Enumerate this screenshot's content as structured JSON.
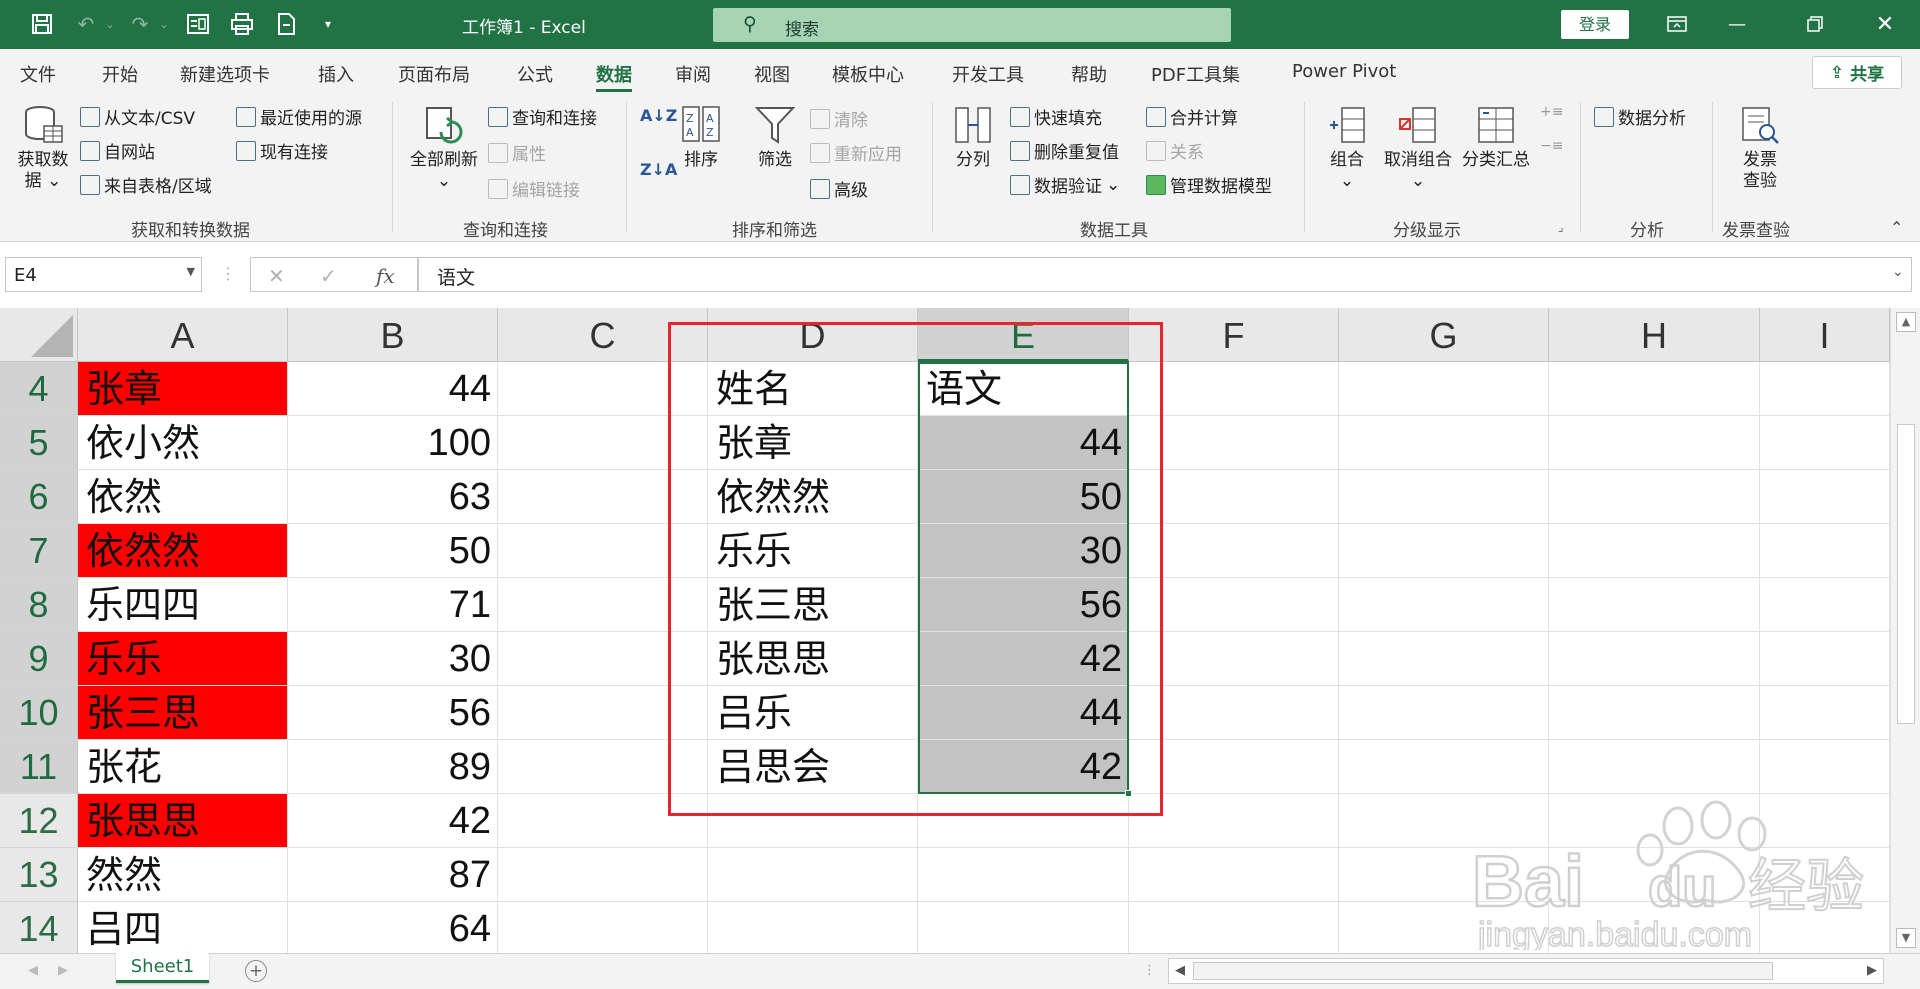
{
  "titlebar": {
    "doc_title": "工作簿1  -  Excel",
    "search_placeholder": "搜索",
    "login_label": "登录"
  },
  "ribbon_tabs": [
    "文件",
    "开始",
    "新建选项卡",
    "插入",
    "页面布局",
    "公式",
    "数据",
    "审阅",
    "视图",
    "模板中心",
    "开发工具",
    "帮助",
    "PDF工具集",
    "Power Pivot"
  ],
  "active_tab": "数据",
  "share_label": "共享",
  "ribbon": {
    "get_data": {
      "label1": "获取数",
      "label2": "据 ⌄"
    },
    "from_text": "从文本/CSV",
    "from_web": "自网站",
    "from_table": "来自表格/区域",
    "recent_sources": "最近使用的源",
    "existing_conn": "现有连接",
    "group_get": "获取和转换数据",
    "refresh_all": "全部刷新",
    "queries_conn": "查询和连接",
    "properties": "属性",
    "edit_links": "编辑链接",
    "group_query": "查询和连接",
    "sort": "排序",
    "filter": "筛选",
    "clear": "清除",
    "reapply": "重新应用",
    "advanced": "高级",
    "group_sort": "排序和筛选",
    "text_to_columns": "分列",
    "flash_fill": "快速填充",
    "remove_dup": "删除重复值",
    "data_validation": "数据验证",
    "consolidate": "合并计算",
    "relationships": "关系",
    "data_model": "管理数据模型",
    "group_tools": "数据工具",
    "group_btn": "组合",
    "ungroup_btn": "取消组合",
    "subtotal": "分类汇总",
    "group_outline": "分级显示",
    "data_analysis": "数据分析",
    "group_analysis": "分析",
    "invoice_check1": "发票",
    "invoice_check2": "查验",
    "group_invoice": "发票查验"
  },
  "formula_bar": {
    "name_box": "E4",
    "formula": "语文"
  },
  "columns": [
    "A",
    "B",
    "C",
    "D",
    "E",
    "F",
    "G",
    "H",
    "I"
  ],
  "rows": [
    {
      "num": "4",
      "A": "张章",
      "B": "44",
      "D": "姓名",
      "E": "语文",
      "redA": true
    },
    {
      "num": "5",
      "A": "依小然",
      "B": "100",
      "D": "张章",
      "E": "44",
      "redA": false
    },
    {
      "num": "6",
      "A": "依然",
      "B": "63",
      "D": "依然然",
      "E": "50",
      "redA": false
    },
    {
      "num": "7",
      "A": "依然然",
      "B": "50",
      "D": "乐乐",
      "E": "30",
      "redA": true
    },
    {
      "num": "8",
      "A": "乐四四",
      "B": "71",
      "D": "张三思",
      "E": "56",
      "redA": false
    },
    {
      "num": "9",
      "A": "乐乐",
      "B": "30",
      "D": "张思思",
      "E": "42",
      "redA": true
    },
    {
      "num": "10",
      "A": "张三思",
      "B": "56",
      "D": "吕乐",
      "E": "44",
      "redA": true
    },
    {
      "num": "11",
      "A": "张花",
      "B": "89",
      "D": "吕思会",
      "E": "42",
      "redA": false
    },
    {
      "num": "12",
      "A": "张思思",
      "B": "42",
      "D": "",
      "E": "",
      "redA": true
    },
    {
      "num": "13",
      "A": "然然",
      "B": "87",
      "D": "",
      "E": "",
      "redA": false
    },
    {
      "num": "14",
      "A": "吕四",
      "B": "64",
      "D": "",
      "E": "",
      "redA": false
    }
  ],
  "sheet_tab": "Sheet1",
  "colors": {
    "excel_green": "#217346",
    "highlight_red": "#ff0000",
    "selection_gray": "#c3c3c3",
    "annotation_red": "#e8242c"
  },
  "watermark": {
    "brand": "Baidu经验",
    "url": "jingyan.baidu.com"
  }
}
